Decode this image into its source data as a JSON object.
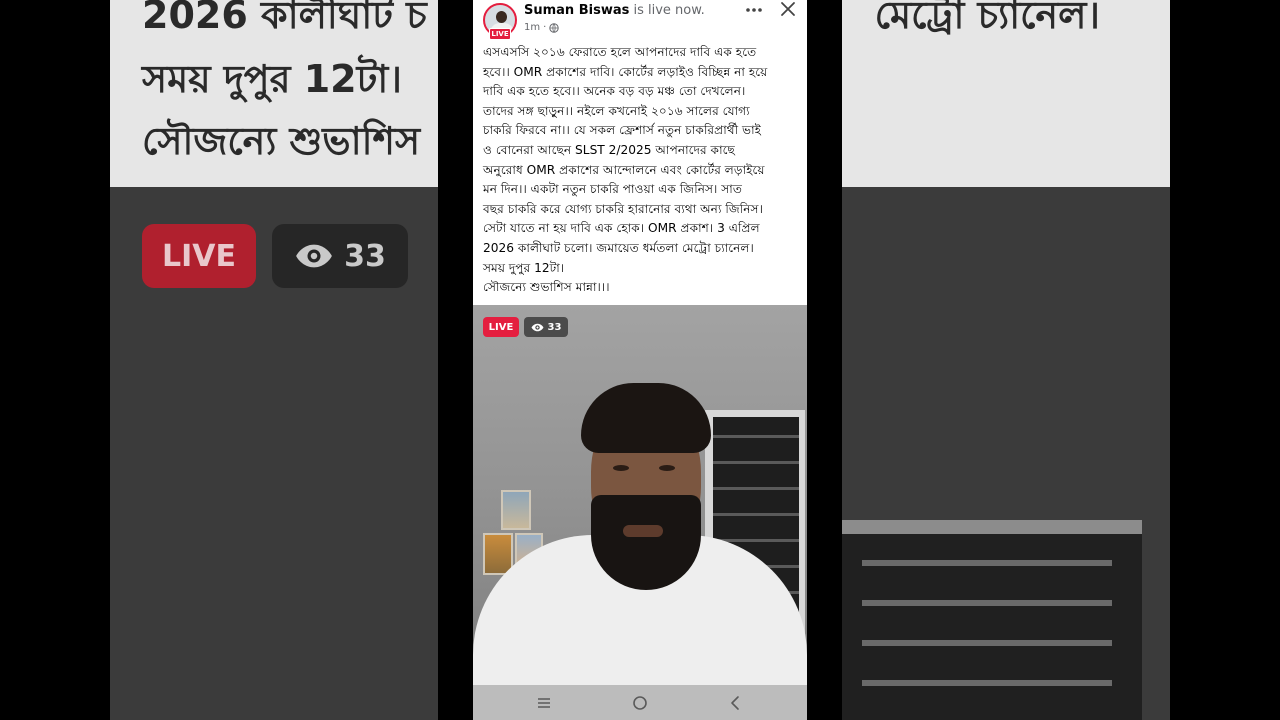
{
  "background": {
    "left_lines": [
      "2026 কালীঘাট চ",
      "সময় দুপুর 12টা।",
      "সৌজন্যে শুভাশিস"
    ],
    "right_lines": [
      "মেট্রো চ্যানেল।"
    ],
    "live_label": "LIVE",
    "view_count": "33"
  },
  "post": {
    "author_name": "Suman Biswas",
    "status_text": "is live now.",
    "time": "1m",
    "avatar_live_label": "LIVE",
    "caption_lines": [
      "এসএসসি ২০১৬  ফেরাতে হলে আপনাদের দাবি এক হতে",
      "হবে।। OMR প্রকাশের দাবি। কোর্টের লড়াইও বিচ্ছিন্ন না হয়ে",
      "দাবি এক হতে হবে।। অনেক বড় বড় মঞ্চ তো দেখলেন।",
      "তাদের সঙ্গ ছাড়ুন।। নইলে কখনোই ২০১৬ সালের যোগ্য",
      "চাকরি ফিরবে না।। যে সকল ফ্রেশার্স নতুন চাকরিপ্রার্থী ভাই",
      "ও বোনেরা আছেন SLST 2/2025 আপনাদের কাছে",
      "অনুরোধ OMR প্রকাশের আন্দোলনে এবং কোর্টের লড়াইয়ে",
      "মন দিন।। একটা নতুন চাকরি পাওয়া এক জিনিস। সাত",
      "বছর চাকরি করে যোগ্য চাকরি হারানোর ব্যথা অন্য জিনিস।",
      "সেটা যাতে না হয় দাবি এক হোক। OMR প্রকাশ। 3 এপ্রিল",
      "2026 কালীঘাট চলো। জমায়েত ধর্মতলা মেট্রো চ্যানেল।",
      "সময় দুপুর 12টা।",
      "সৌজন্যে শুভাশিস মান্না।।।"
    ]
  },
  "video": {
    "live_label": "LIVE",
    "view_count": "33"
  },
  "icons": {
    "more": "more-options-icon",
    "close": "close-icon",
    "eye": "eye-icon",
    "globe": "globe-icon",
    "nav_recents": "recents-icon",
    "nav_home": "home-icon",
    "nav_back": "back-icon"
  },
  "colors": {
    "live_red": "#e41e3f",
    "text": "#050505",
    "secondary_text": "#65676b",
    "navbar": "#bcbcbc"
  }
}
